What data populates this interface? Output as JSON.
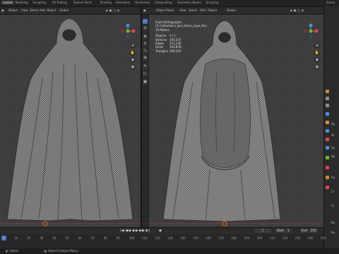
{
  "workspace_tabs": [
    "Layout",
    "Modeling",
    "Sculpting",
    "UV Editing",
    "Texture Paint",
    "Shading",
    "Animation",
    "Rendering",
    "Compositing",
    "Geometry Nodes",
    "Scripting"
  ],
  "scene_label": "Scene",
  "left_header": {
    "mode": "Object",
    "items": [
      "View",
      "Select",
      "Add",
      "Object"
    ],
    "transform": "Global"
  },
  "right_header": {
    "mode": "Object Mode",
    "items": [
      "View",
      "Select",
      "Add",
      "Object"
    ],
    "transform": "Global"
  },
  "options_label": "Options",
  "stats": {
    "view": "Front Orthographic",
    "collection": "(1) Collection | jaca_dress_cape_thin",
    "scale": "10 Meters",
    "rows": [
      {
        "k": "Objects",
        "v": "0 / 1"
      },
      {
        "k": "Vertices",
        "v": "105,547"
      },
      {
        "k": "Edges",
        "v": "211,236"
      },
      {
        "k": "Faces",
        "v": "104,878"
      },
      {
        "k": "Triangles",
        "v": "209,315"
      }
    ]
  },
  "timeline": {
    "ticks": [
      "0",
      "10",
      "20",
      "30",
      "40",
      "50",
      "60",
      "70",
      "80",
      "90",
      "100",
      "110",
      "120",
      "130",
      "140",
      "150",
      "160",
      "170",
      "180",
      "190",
      "200",
      "210",
      "220",
      "230",
      "240",
      "250"
    ],
    "current_frame": "1",
    "start_label": "Start",
    "start": "1",
    "end_label": "End",
    "end": "250"
  },
  "status": {
    "left": "Select",
    "right": "Object Context Menu"
  },
  "props_labels": [
    "Sp",
    "Sc",
    "Sp",
    "Sp",
    "Au",
    "Cl",
    "Cl",
    "Ru",
    "Ru"
  ],
  "colors": {
    "viewport_bg": "#3d3d3d",
    "accent_blue": "#4772b3",
    "axis_red": "#d94b54",
    "axis_green": "#72b52d",
    "axis_blue": "#4d8de0"
  }
}
